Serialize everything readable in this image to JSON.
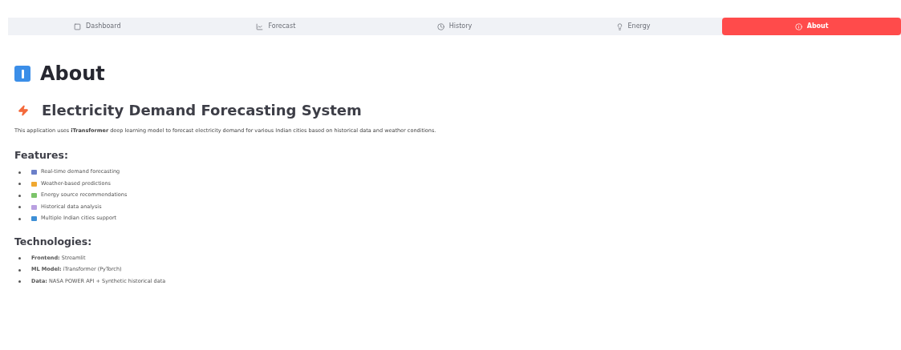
{
  "tabs": [
    {
      "label": "Dashboard",
      "kind": "dashboard",
      "selected": false
    },
    {
      "label": "Forecast",
      "kind": "forecast",
      "selected": false
    },
    {
      "label": "History",
      "kind": "history",
      "selected": false
    },
    {
      "label": "Energy",
      "kind": "energy",
      "selected": false
    },
    {
      "label": "About",
      "kind": "about",
      "selected": true
    }
  ],
  "page_title": "About",
  "section_title": "Electricity Demand Forecasting System",
  "description": "This application uses **iTransformer** deep learning model to forecast electricity demand for various Indian cities based on historical data and weather conditions.",
  "features": {
    "heading": "Features:",
    "items": [
      {
        "text": "Real-time demand forecasting",
        "color": "#6b7fc9"
      },
      {
        "text": "Weather-based predictions",
        "color": "#f0a830"
      },
      {
        "text": "Energy source recommendations",
        "color": "#7cc46a"
      },
      {
        "text": "Historical data analysis",
        "color": "#b9a0e0"
      },
      {
        "text": "Multiple Indian cities support",
        "color": "#3d8fd6"
      }
    ]
  },
  "technologies": {
    "heading": "Technologies:",
    "items": [
      "**Frontend:** Streamlit",
      "**ML Model:** iTransformer (PyTorch)",
      "**Data:** NASA POWER API + Synthetic historical data"
    ]
  }
}
